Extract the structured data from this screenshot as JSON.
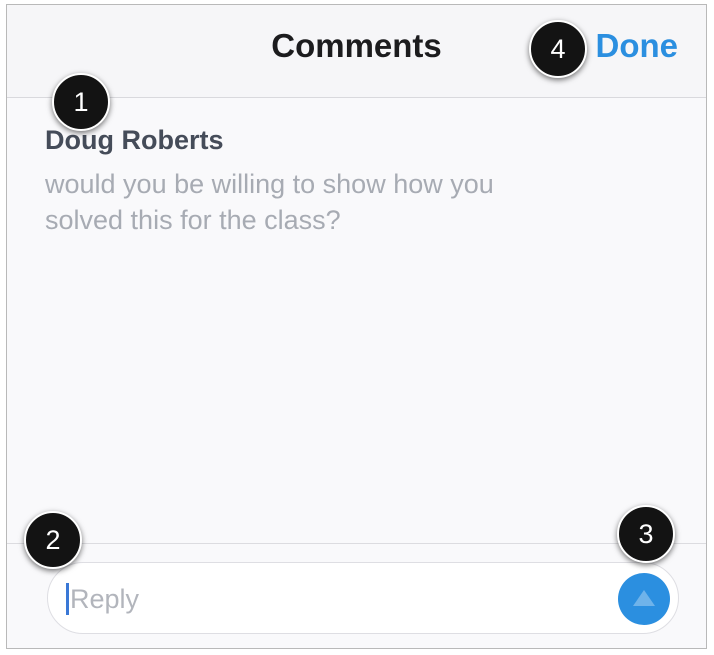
{
  "header": {
    "title": "Comments",
    "done_label": "Done"
  },
  "comment": {
    "author": "Doug Roberts",
    "body_line1": "would you be willing to show how you",
    "body_line2": "solved this for the class?"
  },
  "composer": {
    "placeholder": "Reply",
    "send_icon": "send-arrow-icon"
  },
  "callouts": [
    "1",
    "2",
    "3",
    "4"
  ],
  "colors": {
    "accent": "#2b8fe0",
    "callout": "#131313"
  }
}
